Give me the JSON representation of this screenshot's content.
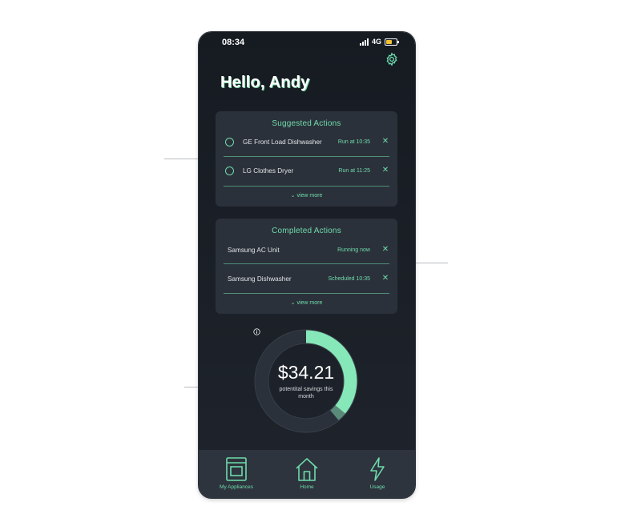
{
  "status": {
    "time": "08:34",
    "network": "4G",
    "battery_level": 0.6
  },
  "header": {
    "greeting": "Hello, Andy"
  },
  "suggested": {
    "title": "Suggested Actions",
    "items": [
      {
        "name": "GE Front Load Dishwasher",
        "meta": "Run at 10:35"
      },
      {
        "name": "LG Clothes Dryer",
        "meta": "Run at 11:25"
      }
    ],
    "view_more": "⌄ view more"
  },
  "completed": {
    "title": "Completed Actions",
    "items": [
      {
        "name": "Samsung AC Unit",
        "meta": "Running now"
      },
      {
        "name": "Samsung Dishwasher",
        "meta": "Scheduled 10:35"
      }
    ],
    "view_more": "⌄ view more"
  },
  "savings": {
    "amount": "$34.21",
    "label": "potentital savings this month",
    "progress": 0.36,
    "secondary_progress": 0.03
  },
  "nav": [
    {
      "label": "My Appliances",
      "icon": "appliance-icon"
    },
    {
      "label": "Home",
      "icon": "home-icon"
    },
    {
      "label": "Usage",
      "icon": "lightning-icon"
    }
  ],
  "colors": {
    "accent": "#6fdbac",
    "background": "#1a1f26",
    "card": "#2b313a",
    "nav": "#2d343d"
  }
}
